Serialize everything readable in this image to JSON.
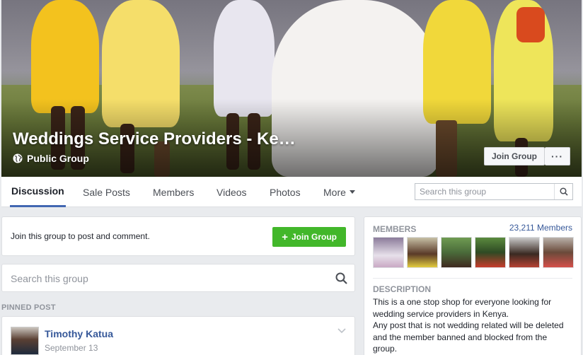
{
  "group": {
    "title": "Weddings Service Providers - Ke…",
    "type": "Public Group",
    "join_label": "Join Group",
    "more_label": "···"
  },
  "nav": {
    "tabs": [
      {
        "label": "Discussion",
        "active": true
      },
      {
        "label": "Sale Posts"
      },
      {
        "label": "Members"
      },
      {
        "label": "Videos"
      },
      {
        "label": "Photos"
      },
      {
        "label": "More"
      }
    ],
    "search_placeholder": "Search this group"
  },
  "join_prompt": {
    "text": "Join this group to post and comment.",
    "button_label": "Join Group"
  },
  "group_search": {
    "placeholder": "Search this group"
  },
  "pinned": {
    "label": "PINNED POST",
    "author": "Timothy Katua",
    "date": "September 13"
  },
  "sidebar": {
    "members_label": "MEMBERS",
    "members_count": "23,211 Members",
    "description_label": "DESCRIPTION",
    "description_lines": [
      "This is a one stop shop for everyone looking for",
      "wedding service providers in Kenya.",
      "Any post that is not wedding related will be deleted",
      "and the member banned and blocked from the",
      "group."
    ]
  },
  "colors": {
    "accent": "#4267b2",
    "link": "#365899",
    "join_green": "#42b72a",
    "page_bg": "#e9ebee"
  }
}
